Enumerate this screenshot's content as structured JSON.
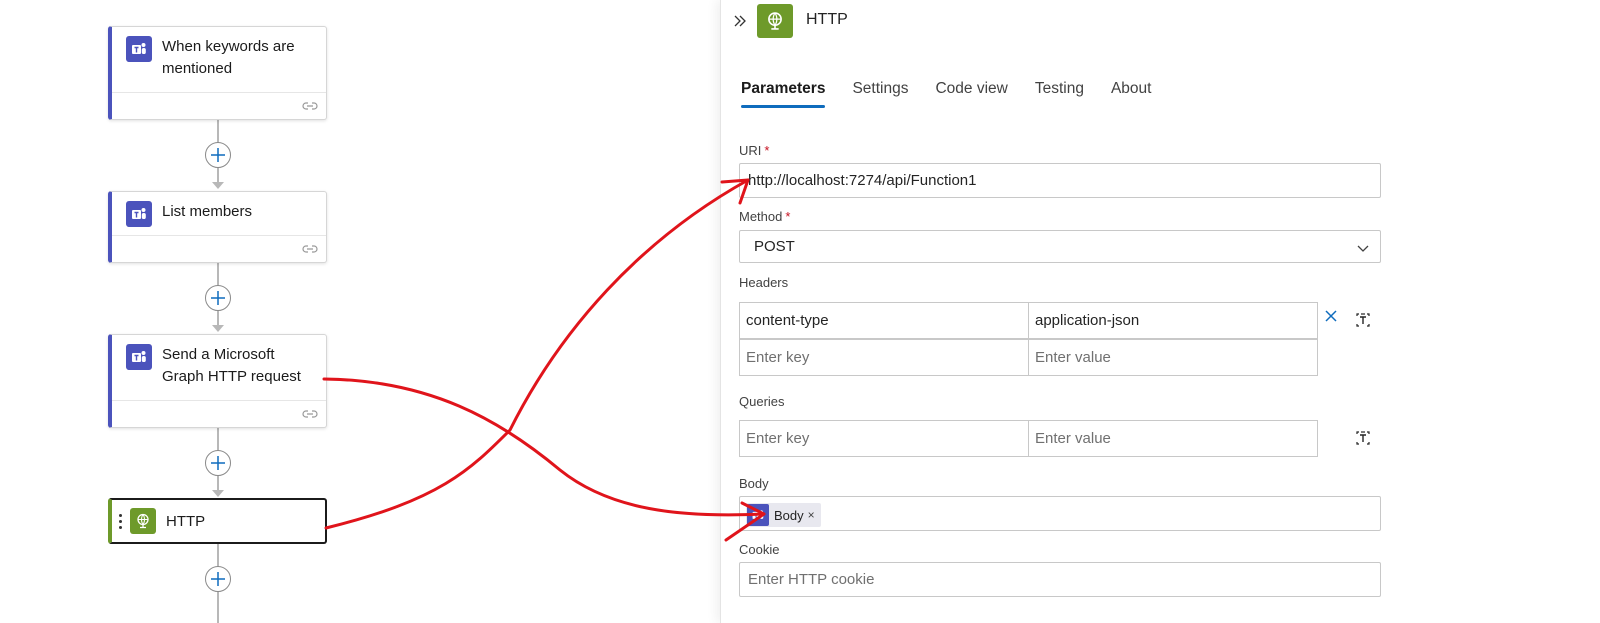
{
  "flow": {
    "steps": [
      {
        "title": "When keywords are mentioned",
        "line1": "When keywords are",
        "line2": "mentioned"
      },
      {
        "title": "List members"
      },
      {
        "title": "Send a Microsoft Graph HTTP request",
        "line1": "Send a Microsoft",
        "line2": "Graph HTTP request"
      },
      {
        "title": "HTTP"
      }
    ]
  },
  "panel": {
    "title": "HTTP",
    "tabs": [
      {
        "label": "Parameters",
        "active": true
      },
      {
        "label": "Settings",
        "active": false
      },
      {
        "label": "Code view",
        "active": false
      },
      {
        "label": "Testing",
        "active": false
      },
      {
        "label": "About",
        "active": false
      }
    ],
    "uri": {
      "label": "URI",
      "required_mark": "*",
      "value": "http://localhost:7274/api/Function1"
    },
    "method": {
      "label": "Method",
      "required_mark": "*",
      "value": "POST"
    },
    "headers": {
      "label": "Headers",
      "rows": [
        {
          "key": "content-type",
          "value": "application-json"
        }
      ],
      "key_placeholder": "Enter key",
      "value_placeholder": "Enter value"
    },
    "queries": {
      "label": "Queries",
      "key_placeholder": "Enter key",
      "value_placeholder": "Enter value"
    },
    "body": {
      "label": "Body",
      "token_label": "Body",
      "token_remove": "×"
    },
    "cookie": {
      "label": "Cookie",
      "placeholder": "Enter HTTP cookie"
    }
  },
  "colors": {
    "teams_purple": "#4b53bc",
    "http_green": "#6e9a2a",
    "tab_accent": "#0f6cbd",
    "annotation_red": "#e0141b",
    "required_red": "#c50f1f"
  }
}
